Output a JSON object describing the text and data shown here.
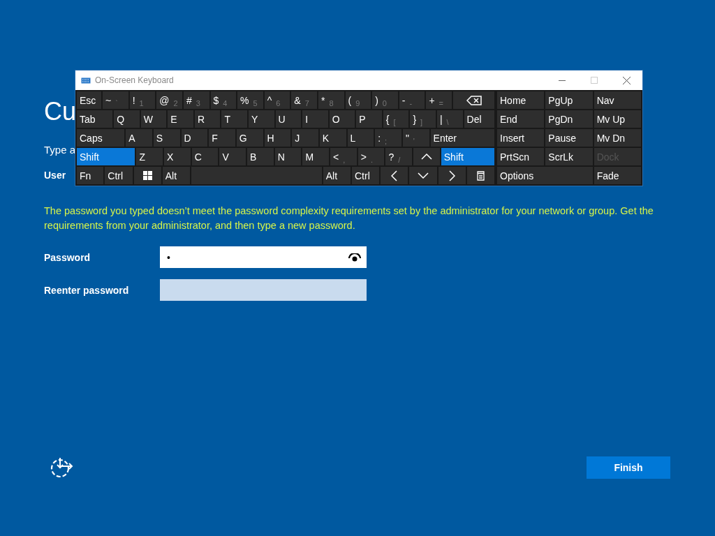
{
  "page": {
    "heading": "Cu",
    "intro": "Type a",
    "username": {
      "label": "User"
    },
    "error": "The password you typed doesn’t meet the password complexity requirements set by the administrator for your network or group. Get the requirements from your administrator, and then type a new password.",
    "password": {
      "label": "Password",
      "value": "•"
    },
    "reenter": {
      "label": "Reenter password"
    },
    "finish": "Finish"
  },
  "keyboard": {
    "title": "On-Screen Keyboard",
    "rows": [
      [
        {
          "kind": "text",
          "label": "Esc",
          "on": false
        },
        {
          "kind": "dual",
          "label": "~",
          "alt": "`",
          "on": false
        },
        {
          "kind": "dual",
          "label": "!",
          "alt": "1",
          "on": false
        },
        {
          "kind": "dual",
          "label": "@",
          "alt": "2",
          "on": false
        },
        {
          "kind": "dual",
          "label": "#",
          "alt": "3",
          "on": false
        },
        {
          "kind": "dual",
          "label": "$",
          "alt": "4",
          "on": false
        },
        {
          "kind": "dual",
          "label": "%",
          "alt": "5",
          "on": false
        },
        {
          "kind": "dual",
          "label": "^",
          "alt": "6",
          "on": false
        },
        {
          "kind": "dual",
          "label": "&",
          "alt": "7",
          "on": false
        },
        {
          "kind": "dual",
          "label": "*",
          "alt": "8",
          "on": false
        },
        {
          "kind": "dual",
          "label": "(",
          "alt": "9",
          "on": false
        },
        {
          "kind": "dual",
          "label": ")",
          "alt": "0",
          "on": false
        },
        {
          "kind": "dual",
          "label": "-",
          "alt": "-",
          "on": false
        },
        {
          "kind": "dual",
          "label": "+",
          "alt": "=",
          "on": false
        },
        {
          "kind": "backspace",
          "on": false
        }
      ],
      [
        {
          "kind": "text",
          "label": "Tab",
          "on": false
        },
        {
          "kind": "text",
          "label": "Q",
          "on": false
        },
        {
          "kind": "text",
          "label": "W",
          "on": false
        },
        {
          "kind": "text",
          "label": "E",
          "on": false
        },
        {
          "kind": "text",
          "label": "R",
          "on": false
        },
        {
          "kind": "text",
          "label": "T",
          "on": false
        },
        {
          "kind": "text",
          "label": "Y",
          "on": false
        },
        {
          "kind": "text",
          "label": "U",
          "on": false
        },
        {
          "kind": "text",
          "label": "I",
          "on": false
        },
        {
          "kind": "text",
          "label": "O",
          "on": false
        },
        {
          "kind": "text",
          "label": "P",
          "on": false
        },
        {
          "kind": "dual",
          "label": "{",
          "alt": "[",
          "on": false
        },
        {
          "kind": "dual",
          "label": "}",
          "alt": "]",
          "on": false
        },
        {
          "kind": "dual",
          "label": "|",
          "alt": "\\",
          "on": false
        },
        {
          "kind": "text",
          "label": "Del",
          "on": false
        }
      ],
      [
        {
          "kind": "text",
          "label": "Caps",
          "on": false
        },
        {
          "kind": "text",
          "label": "A",
          "on": false
        },
        {
          "kind": "text",
          "label": "S",
          "on": false
        },
        {
          "kind": "text",
          "label": "D",
          "on": false
        },
        {
          "kind": "text",
          "label": "F",
          "on": false
        },
        {
          "kind": "text",
          "label": "G",
          "on": false
        },
        {
          "kind": "text",
          "label": "H",
          "on": false
        },
        {
          "kind": "text",
          "label": "J",
          "on": false
        },
        {
          "kind": "text",
          "label": "K",
          "on": false
        },
        {
          "kind": "text",
          "label": "L",
          "on": false
        },
        {
          "kind": "dual",
          "label": ":",
          "alt": ";",
          "on": false
        },
        {
          "kind": "dual",
          "label": "\"",
          "alt": "'",
          "on": false
        },
        {
          "kind": "text",
          "label": "Enter",
          "on": false
        }
      ],
      [
        {
          "kind": "text",
          "label": "Shift",
          "on": true
        },
        {
          "kind": "text",
          "label": "Z",
          "on": false
        },
        {
          "kind": "text",
          "label": "X",
          "on": false
        },
        {
          "kind": "text",
          "label": "C",
          "on": false
        },
        {
          "kind": "text",
          "label": "V",
          "on": false
        },
        {
          "kind": "text",
          "label": "B",
          "on": false
        },
        {
          "kind": "text",
          "label": "N",
          "on": false
        },
        {
          "kind": "text",
          "label": "M",
          "on": false
        },
        {
          "kind": "dual",
          "label": "<",
          "alt": ",",
          "on": false
        },
        {
          "kind": "dual",
          "label": ">",
          "alt": ".",
          "on": false
        },
        {
          "kind": "dual",
          "label": "?",
          "alt": "/",
          "on": false
        },
        {
          "kind": "up",
          "on": false
        },
        {
          "kind": "text",
          "label": "Shift",
          "on": true
        }
      ],
      [
        {
          "kind": "text",
          "label": "Fn",
          "on": false
        },
        {
          "kind": "text",
          "label": "Ctrl",
          "on": false
        },
        {
          "kind": "windows",
          "on": false
        },
        {
          "kind": "text",
          "label": "Alt",
          "on": false
        },
        {
          "kind": "space",
          "on": false
        },
        {
          "kind": "text",
          "label": "Alt",
          "on": false
        },
        {
          "kind": "text",
          "label": "Ctrl",
          "on": false
        },
        {
          "kind": "left",
          "on": false
        },
        {
          "kind": "down",
          "on": false
        },
        {
          "kind": "right",
          "on": false
        },
        {
          "kind": "menu",
          "on": false
        }
      ]
    ],
    "side_keys": [
      {
        "label": "Home",
        "disabled": false
      },
      {
        "label": "PgUp",
        "disabled": false
      },
      {
        "label": "Nav",
        "disabled": false
      },
      {
        "label": "End",
        "disabled": false
      },
      {
        "label": "PgDn",
        "disabled": false
      },
      {
        "label": "Mv Up",
        "disabled": false
      },
      {
        "label": "Insert",
        "disabled": false
      },
      {
        "label": "Pause",
        "disabled": false
      },
      {
        "label": "Mv Dn",
        "disabled": false
      },
      {
        "label": "PrtScn",
        "disabled": false
      },
      {
        "label": "ScrLk",
        "disabled": false
      },
      {
        "label": "Dock",
        "disabled": true
      },
      {
        "label": "Options",
        "disabled": false
      },
      {
        "label": "Fade",
        "disabled": false
      }
    ]
  }
}
